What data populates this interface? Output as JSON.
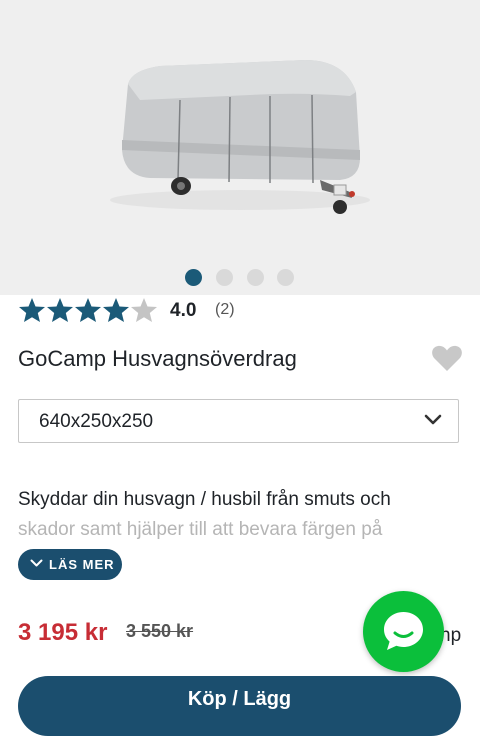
{
  "gallery": {
    "image_alt": "Caravan with grey cover",
    "active_index": 0,
    "slide_count": 4
  },
  "rating": {
    "stars_filled": 4.0,
    "stars_max": 5,
    "value": "4.0",
    "count": "(2)"
  },
  "product": {
    "title": "GoCamp Husvagnsöverdrag"
  },
  "variant_select": {
    "value": "640x250x250"
  },
  "description": {
    "line1": "Skyddar din husvagn / husbil från smuts och",
    "line2": "skador samt hjälper till att bevara färgen på"
  },
  "read_more": {
    "label": "LÄS MER"
  },
  "pricing": {
    "price": "3 195 kr",
    "old_price": "3 550 kr",
    "suffix": "np"
  },
  "cart": {
    "label": "Köp / Lägg"
  },
  "colors": {
    "accent": "#1b4e6e",
    "price_red": "#c72d35",
    "chat_green": "#0bbf3b",
    "star": "#1b5a78"
  }
}
